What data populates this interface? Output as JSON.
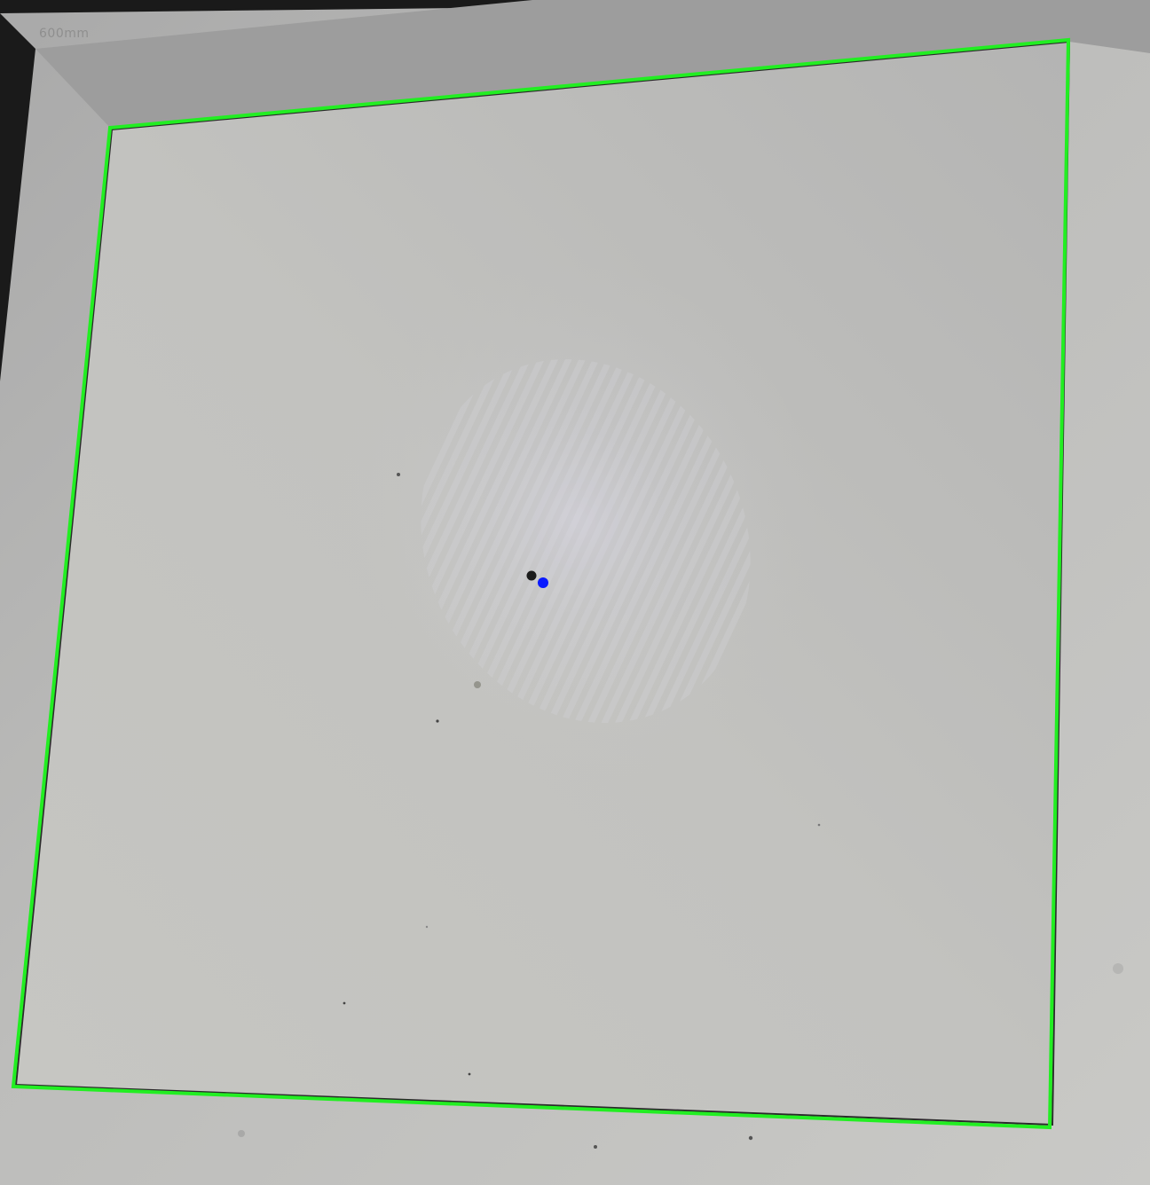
{
  "photo": {
    "faint_label": "600mm"
  },
  "colors": {
    "background_dark": "#1a1a1a",
    "sheet": "#c8c8c5",
    "detected_outline": "#22ee22",
    "printed_border": "#2a2a2a",
    "center_marker": "#0a1aff",
    "hole_dot": "#1c1c1c"
  },
  "overlays": {
    "detected_quad_icon": "green-quadrilateral",
    "center_marker_icon": "blue-dot"
  }
}
